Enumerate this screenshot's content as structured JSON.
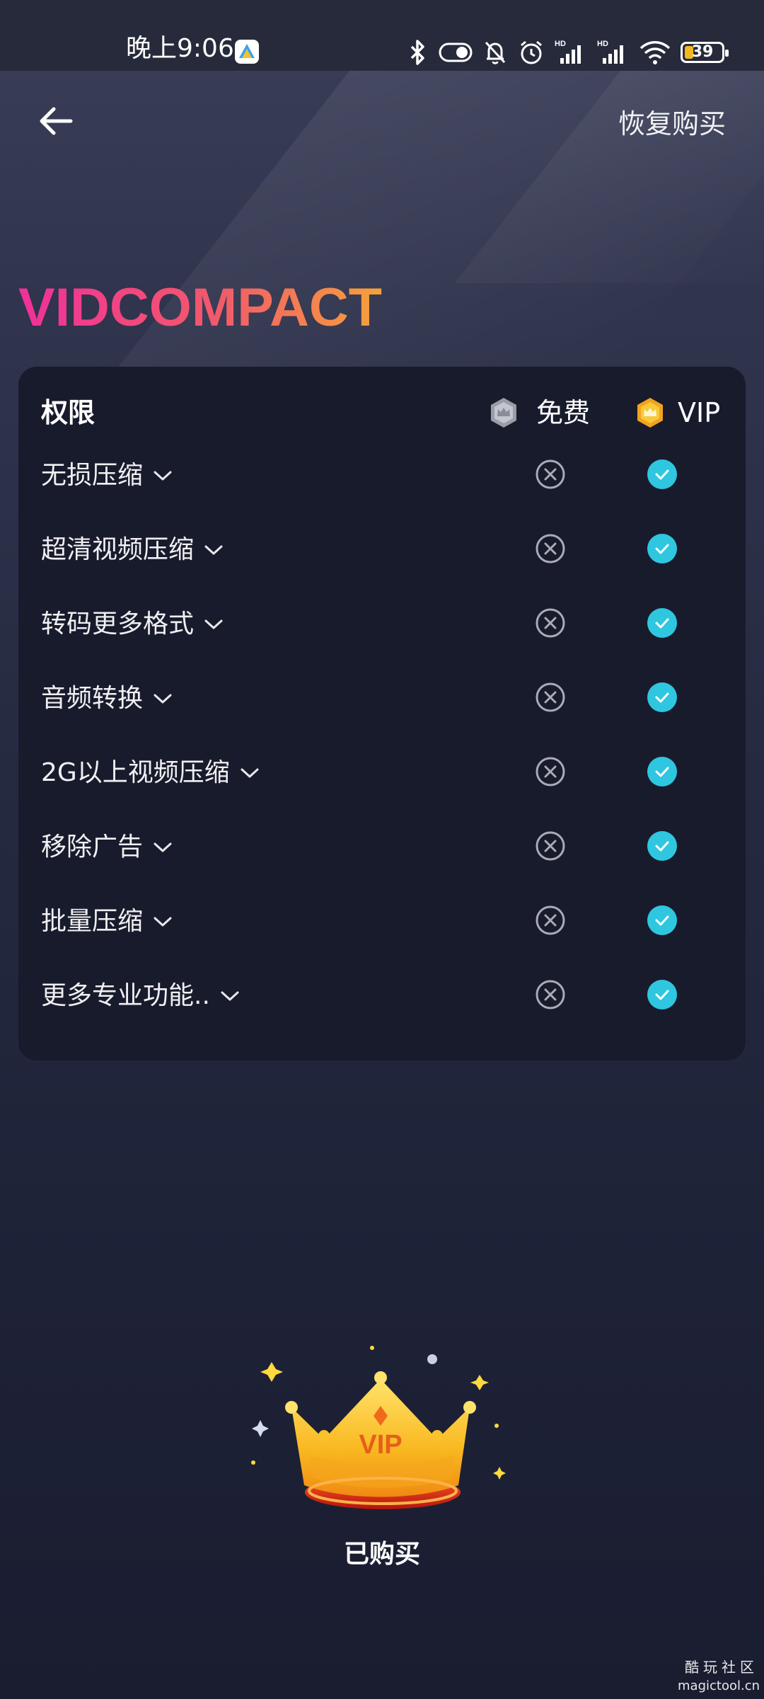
{
  "status_bar": {
    "time": "晚上9:06",
    "battery": "39",
    "icons": [
      "bluetooth-icon",
      "toggle-icon",
      "mute-bell-icon",
      "alarm-icon",
      "signal-hd-1-icon",
      "signal-hd-2-icon",
      "wifi-icon",
      "battery-icon"
    ]
  },
  "header": {
    "back_icon": "arrow-left-icon",
    "restore_label": "恢复购买"
  },
  "logo_text": "VIDCOMPACT",
  "features_card": {
    "title": "权限",
    "free_label": "免费",
    "vip_label": "VIP",
    "rows": [
      {
        "label": "无损压缩",
        "free": false,
        "vip": true
      },
      {
        "label": "超清视频压缩",
        "free": false,
        "vip": true
      },
      {
        "label": "转码更多格式",
        "free": false,
        "vip": true
      },
      {
        "label": "音频转换",
        "free": false,
        "vip": true
      },
      {
        "label": "2G以上视频压缩",
        "free": false,
        "vip": true
      },
      {
        "label": "移除广告",
        "free": false,
        "vip": true
      },
      {
        "label": "批量压缩",
        "free": false,
        "vip": true
      },
      {
        "label": "更多专业功能..",
        "free": false,
        "vip": true
      }
    ]
  },
  "crown_text": "VIP",
  "purchased_label": "已购买",
  "watermark": {
    "line1": "酷玩社区",
    "line2": "magictool.cn"
  },
  "colors": {
    "check": "#2fc6e0",
    "logo_start": "#f0309a",
    "logo_end": "#f5a23a",
    "card_bg": "#181b2c"
  }
}
